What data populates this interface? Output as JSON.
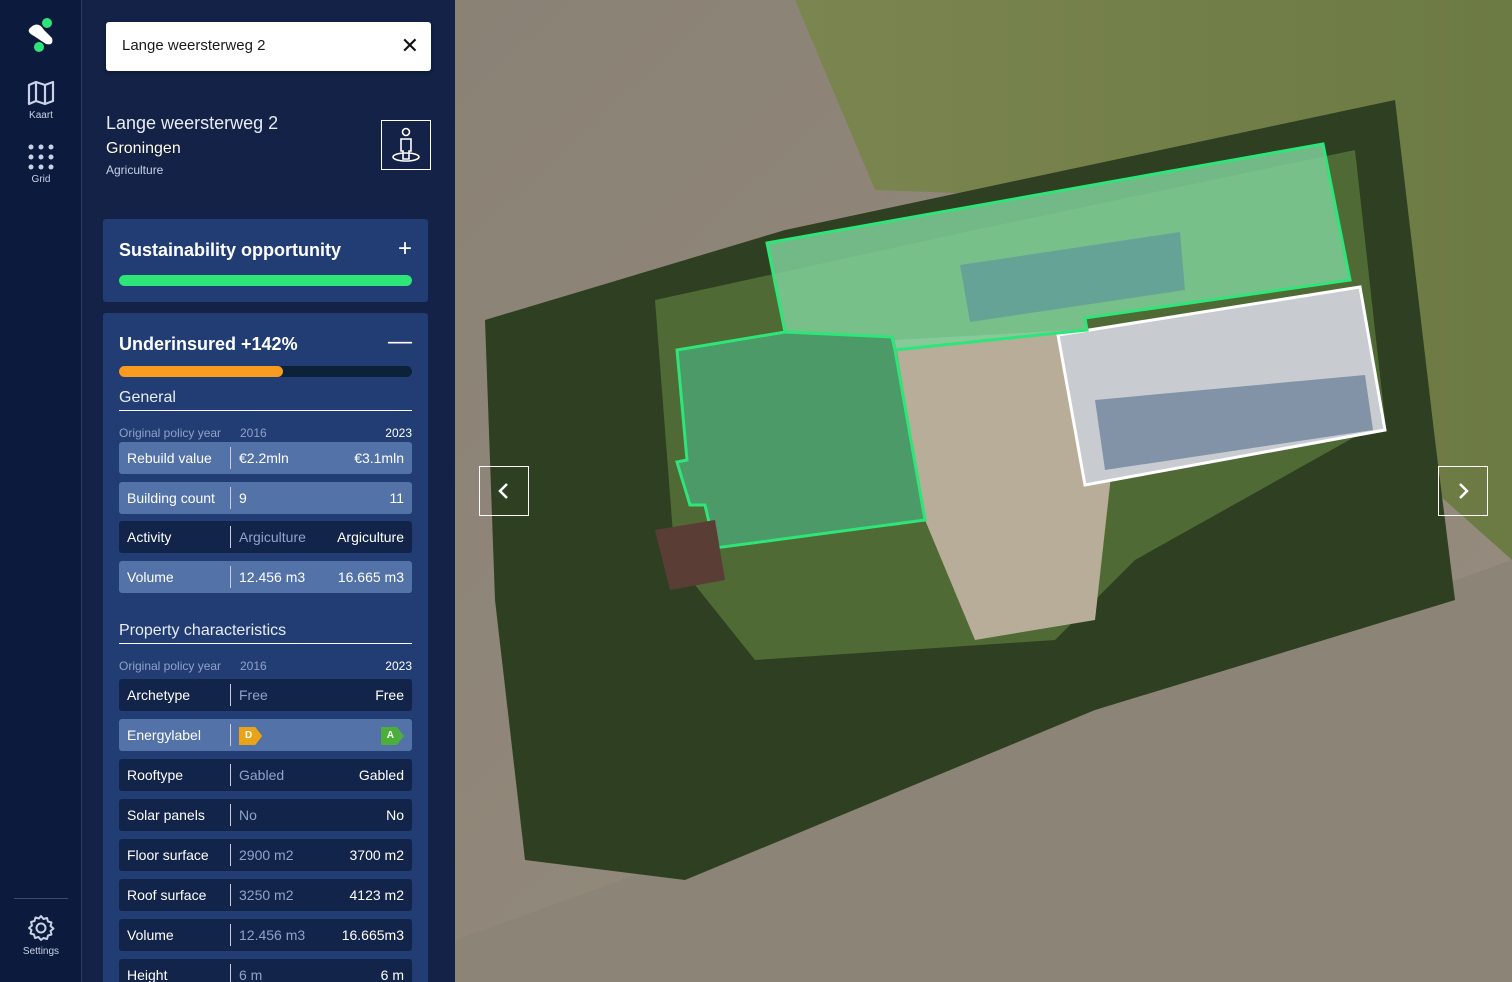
{
  "rail": {
    "items": [
      {
        "label": "Kaart",
        "icon": "map-icon"
      },
      {
        "label": "Grid",
        "icon": "grid-icon"
      }
    ],
    "settings": "Settings"
  },
  "search": {
    "value": "Lange weersterweg 2",
    "clear": "✕"
  },
  "address": {
    "title": "Lange weersterweg 2",
    "city": "Groningen",
    "sector": "Agriculture"
  },
  "sustainability": {
    "title": "Sustainability opportunity",
    "toggle": "+",
    "progress": 1.0,
    "color": "#2ee57a"
  },
  "underinsured": {
    "title": "Underinsured +142%",
    "toggle": "—",
    "progress": 0.56,
    "color": "#f89b1f",
    "general": {
      "title": "General",
      "header": {
        "label": "Original policy year",
        "old": "2016",
        "new": "2023"
      },
      "rows": [
        {
          "key": "Rebuild value",
          "old": "€2.2mln",
          "new": "€3.1mln"
        },
        {
          "key": "Building count",
          "old": "9",
          "new": "11"
        },
        {
          "key": "Activity",
          "old": "Argiculture",
          "new": "Argiculture"
        },
        {
          "key": "Volume",
          "old": "12.456 m3",
          "new": "16.665 m3"
        }
      ]
    },
    "property": {
      "title": "Property characteristics",
      "header": {
        "label": "Original policy year",
        "old": "2016",
        "new": "2023"
      },
      "rows": [
        {
          "key": "Archetype",
          "old": "Free",
          "new": "Free"
        },
        {
          "key": "Energylabel",
          "old": "D",
          "new": "A"
        },
        {
          "key": "Rooftype",
          "old": "Gabled",
          "new": "Gabled"
        },
        {
          "key": "Solar panels",
          "old": "No",
          "new": "No"
        },
        {
          "key": "Floor surface",
          "old": "2900 m2",
          "new": "3700 m2"
        },
        {
          "key": "Roof surface",
          "old": "3250 m2",
          "new": "4123 m2"
        },
        {
          "key": "Volume",
          "old": "12.456 m3",
          "new": "16.665m3"
        },
        {
          "key": "Height",
          "old": "6 m",
          "new": "6 m"
        }
      ]
    }
  },
  "colors": {
    "label_d": "#e8a317",
    "label_a": "#4caf3c",
    "outline": "#2ee57a"
  }
}
